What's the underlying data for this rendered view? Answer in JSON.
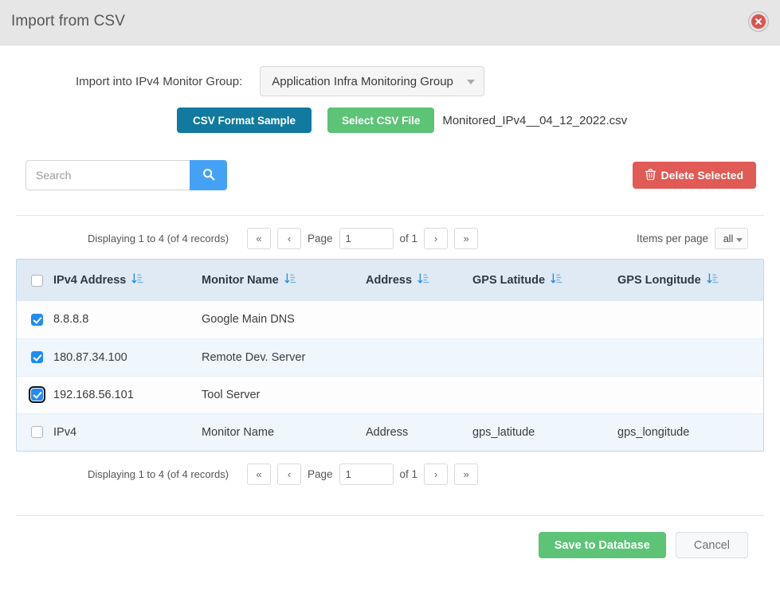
{
  "header": {
    "title": "Import from CSV",
    "close_label": "×"
  },
  "form": {
    "group_label": "Import into IPv4 Monitor Group:",
    "group_value": "Application Infra Monitoring Group",
    "csv_sample_button": "CSV Format Sample",
    "select_file_button": "Select CSV File",
    "file_name": "Monitored_IPv4__04_12_2022.csv"
  },
  "tools": {
    "search_placeholder": "Search",
    "search_value": "",
    "delete_button": "Delete Selected"
  },
  "pagination": {
    "info": "Displaying 1 to 4 (of 4 records)",
    "first": "«",
    "prev": "‹",
    "page_label": "Page",
    "page_value": "1",
    "of_label": "of 1",
    "next": "›",
    "last": "»",
    "items_per_page_label": "Items per page",
    "items_per_page_value": "all"
  },
  "table": {
    "columns": [
      {
        "label": "IPv4 Address"
      },
      {
        "label": "Monitor Name"
      },
      {
        "label": "Address"
      },
      {
        "label": "GPS Latitude"
      },
      {
        "label": "GPS Longitude"
      }
    ],
    "rows": [
      {
        "ipv4": "8.8.8.8",
        "monitor_name": "Google Main DNS",
        "address": "",
        "gps_latitude": "",
        "gps_longitude": ""
      },
      {
        "ipv4": "180.87.34.100",
        "monitor_name": "Remote Dev. Server",
        "address": "",
        "gps_latitude": "",
        "gps_longitude": ""
      },
      {
        "ipv4": "192.168.56.101",
        "monitor_name": "Tool Server",
        "address": "",
        "gps_latitude": "",
        "gps_longitude": ""
      },
      {
        "ipv4": "IPv4",
        "monitor_name": "Monitor Name",
        "address": "Address",
        "gps_latitude": "gps_latitude",
        "gps_longitude": "gps_longitude"
      }
    ]
  },
  "footer": {
    "save_button": "Save to Database",
    "cancel_button": "Cancel"
  },
  "colors": {
    "header_bg": "#e6e6e6",
    "primary_blue": "#117a9e",
    "green": "#5cc377",
    "red": "#e05a56",
    "search_blue": "#45a1f5",
    "table_header_bg": "#dfeaf4",
    "checkbox_blue": "#1f8df5"
  }
}
